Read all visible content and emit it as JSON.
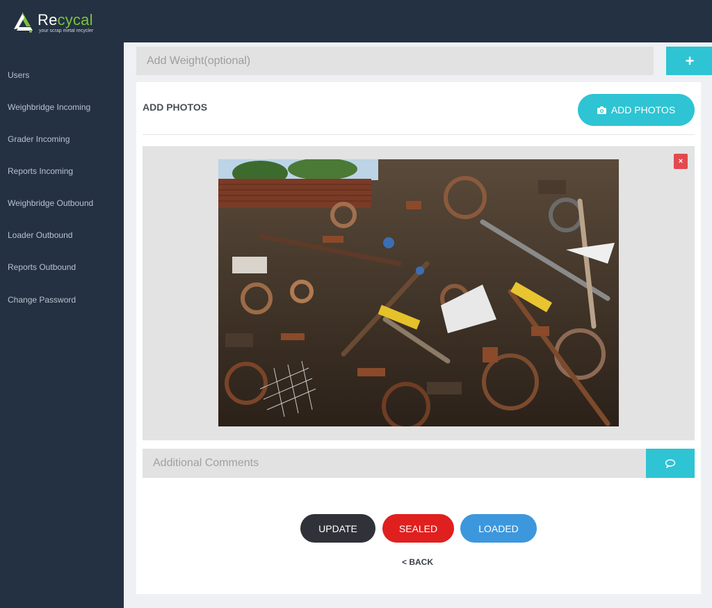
{
  "brand": {
    "name_prefix": "Re",
    "name_accent": "cycal",
    "tagline": "your scrap metal recycler",
    "accent_color": "#7cc13f"
  },
  "sidebar": {
    "items": [
      {
        "label": "Users"
      },
      {
        "label": "Weighbridge Incoming"
      },
      {
        "label": "Grader Incoming"
      },
      {
        "label": "Reports Incoming"
      },
      {
        "label": "Weighbridge Outbound"
      },
      {
        "label": "Loader Outbound"
      },
      {
        "label": "Reports Outbound"
      },
      {
        "label": "Change Password"
      }
    ]
  },
  "weight": {
    "placeholder": "Add Weight(optional)",
    "add_icon": "plus-icon"
  },
  "photos": {
    "heading": "ADD PHOTOS",
    "add_button": "ADD PHOTOS",
    "add_icon": "camera-icon",
    "remove_icon": "close-icon",
    "image_subject": "scrap-metal-pile"
  },
  "comments": {
    "placeholder": "Additional Comments",
    "icon": "speech-bubble-icon"
  },
  "actions": {
    "update": "UPDATE",
    "sealed": "SEALED",
    "loaded": "LOADED",
    "back": "< BACK"
  },
  "colors": {
    "topbar": "#243142",
    "teal": "#2ec4d3",
    "update": "#2f3238",
    "sealed": "#e0201f",
    "loaded": "#3d97dd",
    "remove": "#e34a4f"
  }
}
